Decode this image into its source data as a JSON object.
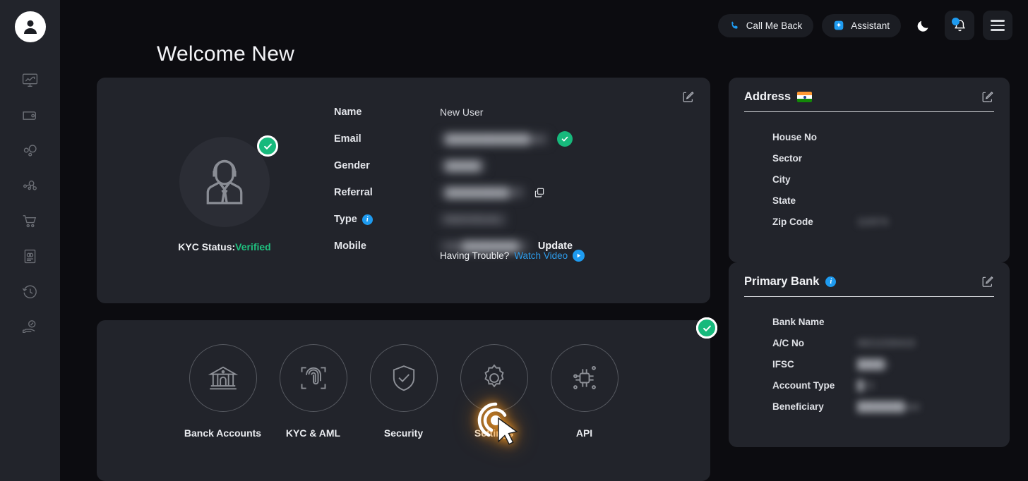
{
  "colors": {
    "page_bg": "#0c0c10",
    "card_bg": "#22242b",
    "accent_blue": "#1e9bf0",
    "success_green": "#17b97c",
    "link_blue": "#2d9ceb"
  },
  "sidebar": {
    "logo_icon": "user-avatar-logo",
    "items": [
      {
        "icon": "dashboard-monitor-icon",
        "name": "dashboard"
      },
      {
        "icon": "wallet-icon",
        "name": "wallet"
      },
      {
        "icon": "bubbles-icon",
        "name": "payouts"
      },
      {
        "icon": "network-share-icon",
        "name": "network"
      },
      {
        "icon": "shopping-cart-icon",
        "name": "orders"
      },
      {
        "icon": "document-money-icon",
        "name": "statements"
      },
      {
        "icon": "history-clock-icon",
        "name": "history"
      },
      {
        "icon": "hand-percent-icon",
        "name": "offers"
      }
    ]
  },
  "header": {
    "call_me_back": "Call Me Back",
    "assistant": "Assistant",
    "theme_toggle_icon": "moon-icon",
    "notification_icon": "bell-icon",
    "menu_icon": "hamburger-menu-icon"
  },
  "page": {
    "title": "Welcome New"
  },
  "profile": {
    "edit_icon": "edit-pencil-icon",
    "avatar_icon": "user-portrait-icon",
    "avatar_badge": "verified-check-badge",
    "kyc_label": "KYC Status:",
    "kyc_value": "Verified",
    "fields": [
      {
        "label": "Name",
        "value": "New User",
        "masked": false
      },
      {
        "label": "Email",
        "value": "████████████om",
        "masked": true
      },
      {
        "label": "Gender",
        "value": "█████",
        "masked": true
      },
      {
        "label": "Referral",
        "value": "█████████27",
        "masked": true
      },
      {
        "label": "Type",
        "value": "INDIVIDUAL",
        "masked": true
      },
      {
        "label": "Mobile",
        "value": "+91████████1",
        "masked": true
      }
    ],
    "email_verified_icon": "green-check-icon",
    "referral_copy_icon": "copy-icon",
    "type_info_icon": "info-icon",
    "update_label": "Update",
    "trouble_text": "Having Trouble?",
    "watch_video_label": "Watch Video",
    "play_icon": "play-circle-icon"
  },
  "tiles": [
    {
      "label": "Banck Accounts",
      "icon": "bank-building-icon",
      "verified": true
    },
    {
      "label": "KYC & AML",
      "icon": "fingerprint-scan-icon",
      "verified": true
    },
    {
      "label": "Security",
      "icon": "shield-check-icon",
      "verified": true
    },
    {
      "label": "Settings",
      "icon": "gear-icon",
      "verified": false
    },
    {
      "label": "API",
      "icon": "chip-api-icon",
      "verified": false
    }
  ],
  "address_card": {
    "title": "Address",
    "flag_icon": "india-flag-icon",
    "edit_icon": "edit-pencil-icon",
    "rows": [
      {
        "label": "House No",
        "value": "",
        "masked": true
      },
      {
        "label": "Sector",
        "value": "",
        "masked": true
      },
      {
        "label": "City",
        "value": "",
        "masked": true
      },
      {
        "label": "State",
        "value": "",
        "masked": true
      },
      {
        "label": "Zip Code",
        "value": "110074",
        "masked": true
      }
    ]
  },
  "bank_card": {
    "title": "Primary Bank",
    "info_icon": "info-icon",
    "edit_icon": "edit-pencil-icon",
    "rows": [
      {
        "label": "Bank Name",
        "value": "",
        "masked": true
      },
      {
        "label": "A/C No",
        "value": "08211530419",
        "masked": true
      },
      {
        "label": "IFSC",
        "value": "████1",
        "masked": true
      },
      {
        "label": "Account Type",
        "value": "█ G",
        "masked": true
      },
      {
        "label": "Beneficiary",
        "value": "███████ave",
        "masked": true
      }
    ]
  },
  "cursor": {
    "marker_icon": "click-cursor-marker"
  }
}
